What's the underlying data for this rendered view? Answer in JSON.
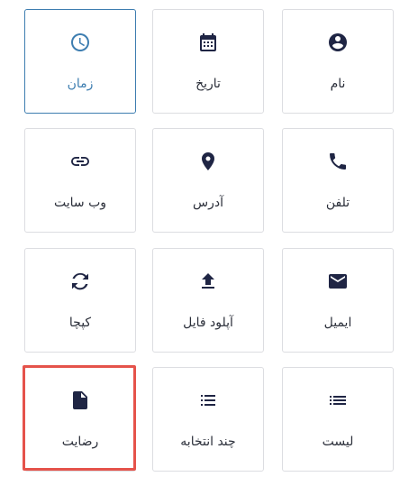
{
  "fields": [
    {
      "label": "زمان",
      "icon": "clock-icon",
      "selected": true
    },
    {
      "label": "تاریخ",
      "icon": "calendar-icon"
    },
    {
      "label": "نام",
      "icon": "account-circle-icon"
    },
    {
      "label": "وب سایت",
      "icon": "link-icon"
    },
    {
      "label": "آدرس",
      "icon": "location-pin-icon"
    },
    {
      "label": "تلفن",
      "icon": "phone-icon"
    },
    {
      "label": "کپچا",
      "icon": "captcha-icon"
    },
    {
      "label": "آپلود فایل",
      "icon": "upload-icon"
    },
    {
      "label": "ایمیل",
      "icon": "email-icon"
    },
    {
      "label": "رضایت",
      "icon": "document-icon",
      "highlighted": true
    },
    {
      "label": "چند انتخابه",
      "icon": "checklist-icon"
    },
    {
      "label": "لیست",
      "icon": "list-icon"
    }
  ],
  "colors": {
    "accent": "#3d7db0",
    "icon": "#1f2544",
    "highlight": "#e5534b",
    "border": "#dcdde1"
  }
}
